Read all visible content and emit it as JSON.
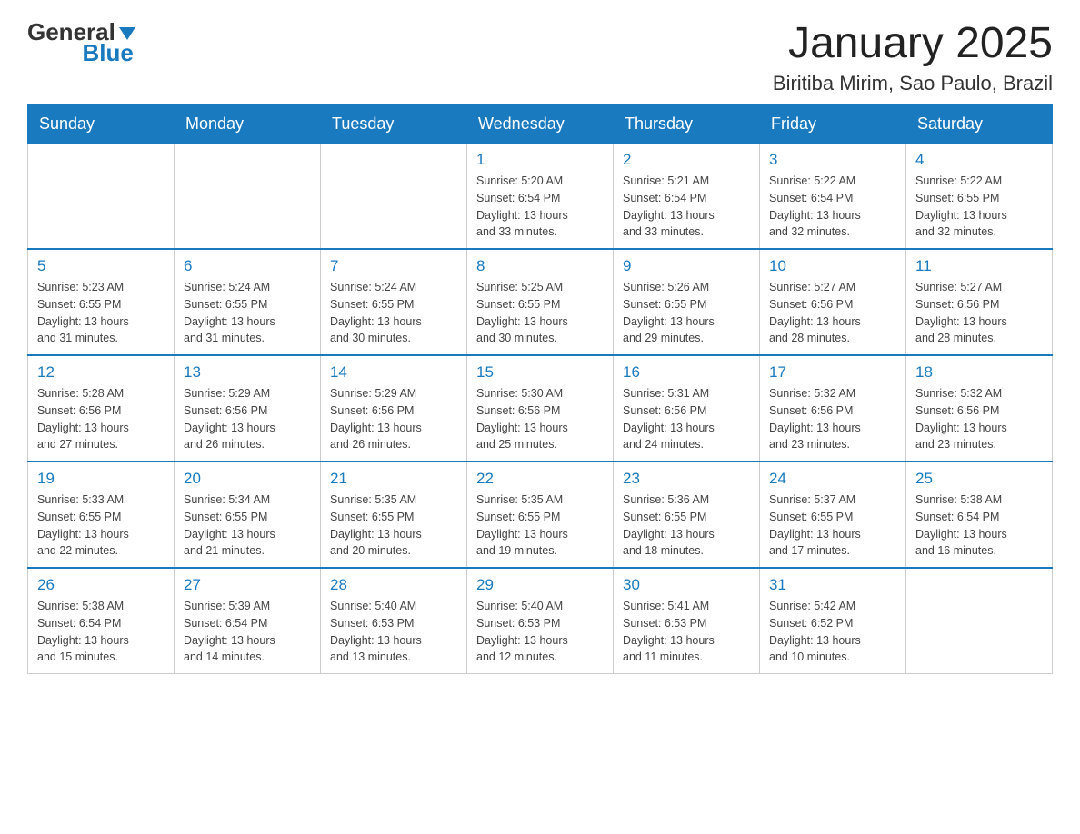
{
  "header": {
    "logo_general": "General",
    "logo_blue": "Blue",
    "title": "January 2025",
    "subtitle": "Biritiba Mirim, Sao Paulo, Brazil"
  },
  "days_of_week": [
    "Sunday",
    "Monday",
    "Tuesday",
    "Wednesday",
    "Thursday",
    "Friday",
    "Saturday"
  ],
  "weeks": [
    [
      {
        "day": "",
        "info": ""
      },
      {
        "day": "",
        "info": ""
      },
      {
        "day": "",
        "info": ""
      },
      {
        "day": "1",
        "info": "Sunrise: 5:20 AM\nSunset: 6:54 PM\nDaylight: 13 hours\nand 33 minutes."
      },
      {
        "day": "2",
        "info": "Sunrise: 5:21 AM\nSunset: 6:54 PM\nDaylight: 13 hours\nand 33 minutes."
      },
      {
        "day": "3",
        "info": "Sunrise: 5:22 AM\nSunset: 6:54 PM\nDaylight: 13 hours\nand 32 minutes."
      },
      {
        "day": "4",
        "info": "Sunrise: 5:22 AM\nSunset: 6:55 PM\nDaylight: 13 hours\nand 32 minutes."
      }
    ],
    [
      {
        "day": "5",
        "info": "Sunrise: 5:23 AM\nSunset: 6:55 PM\nDaylight: 13 hours\nand 31 minutes."
      },
      {
        "day": "6",
        "info": "Sunrise: 5:24 AM\nSunset: 6:55 PM\nDaylight: 13 hours\nand 31 minutes."
      },
      {
        "day": "7",
        "info": "Sunrise: 5:24 AM\nSunset: 6:55 PM\nDaylight: 13 hours\nand 30 minutes."
      },
      {
        "day": "8",
        "info": "Sunrise: 5:25 AM\nSunset: 6:55 PM\nDaylight: 13 hours\nand 30 minutes."
      },
      {
        "day": "9",
        "info": "Sunrise: 5:26 AM\nSunset: 6:55 PM\nDaylight: 13 hours\nand 29 minutes."
      },
      {
        "day": "10",
        "info": "Sunrise: 5:27 AM\nSunset: 6:56 PM\nDaylight: 13 hours\nand 28 minutes."
      },
      {
        "day": "11",
        "info": "Sunrise: 5:27 AM\nSunset: 6:56 PM\nDaylight: 13 hours\nand 28 minutes."
      }
    ],
    [
      {
        "day": "12",
        "info": "Sunrise: 5:28 AM\nSunset: 6:56 PM\nDaylight: 13 hours\nand 27 minutes."
      },
      {
        "day": "13",
        "info": "Sunrise: 5:29 AM\nSunset: 6:56 PM\nDaylight: 13 hours\nand 26 minutes."
      },
      {
        "day": "14",
        "info": "Sunrise: 5:29 AM\nSunset: 6:56 PM\nDaylight: 13 hours\nand 26 minutes."
      },
      {
        "day": "15",
        "info": "Sunrise: 5:30 AM\nSunset: 6:56 PM\nDaylight: 13 hours\nand 25 minutes."
      },
      {
        "day": "16",
        "info": "Sunrise: 5:31 AM\nSunset: 6:56 PM\nDaylight: 13 hours\nand 24 minutes."
      },
      {
        "day": "17",
        "info": "Sunrise: 5:32 AM\nSunset: 6:56 PM\nDaylight: 13 hours\nand 23 minutes."
      },
      {
        "day": "18",
        "info": "Sunrise: 5:32 AM\nSunset: 6:56 PM\nDaylight: 13 hours\nand 23 minutes."
      }
    ],
    [
      {
        "day": "19",
        "info": "Sunrise: 5:33 AM\nSunset: 6:55 PM\nDaylight: 13 hours\nand 22 minutes."
      },
      {
        "day": "20",
        "info": "Sunrise: 5:34 AM\nSunset: 6:55 PM\nDaylight: 13 hours\nand 21 minutes."
      },
      {
        "day": "21",
        "info": "Sunrise: 5:35 AM\nSunset: 6:55 PM\nDaylight: 13 hours\nand 20 minutes."
      },
      {
        "day": "22",
        "info": "Sunrise: 5:35 AM\nSunset: 6:55 PM\nDaylight: 13 hours\nand 19 minutes."
      },
      {
        "day": "23",
        "info": "Sunrise: 5:36 AM\nSunset: 6:55 PM\nDaylight: 13 hours\nand 18 minutes."
      },
      {
        "day": "24",
        "info": "Sunrise: 5:37 AM\nSunset: 6:55 PM\nDaylight: 13 hours\nand 17 minutes."
      },
      {
        "day": "25",
        "info": "Sunrise: 5:38 AM\nSunset: 6:54 PM\nDaylight: 13 hours\nand 16 minutes."
      }
    ],
    [
      {
        "day": "26",
        "info": "Sunrise: 5:38 AM\nSunset: 6:54 PM\nDaylight: 13 hours\nand 15 minutes."
      },
      {
        "day": "27",
        "info": "Sunrise: 5:39 AM\nSunset: 6:54 PM\nDaylight: 13 hours\nand 14 minutes."
      },
      {
        "day": "28",
        "info": "Sunrise: 5:40 AM\nSunset: 6:53 PM\nDaylight: 13 hours\nand 13 minutes."
      },
      {
        "day": "29",
        "info": "Sunrise: 5:40 AM\nSunset: 6:53 PM\nDaylight: 13 hours\nand 12 minutes."
      },
      {
        "day": "30",
        "info": "Sunrise: 5:41 AM\nSunset: 6:53 PM\nDaylight: 13 hours\nand 11 minutes."
      },
      {
        "day": "31",
        "info": "Sunrise: 5:42 AM\nSunset: 6:52 PM\nDaylight: 13 hours\nand 10 minutes."
      },
      {
        "day": "",
        "info": ""
      }
    ]
  ]
}
